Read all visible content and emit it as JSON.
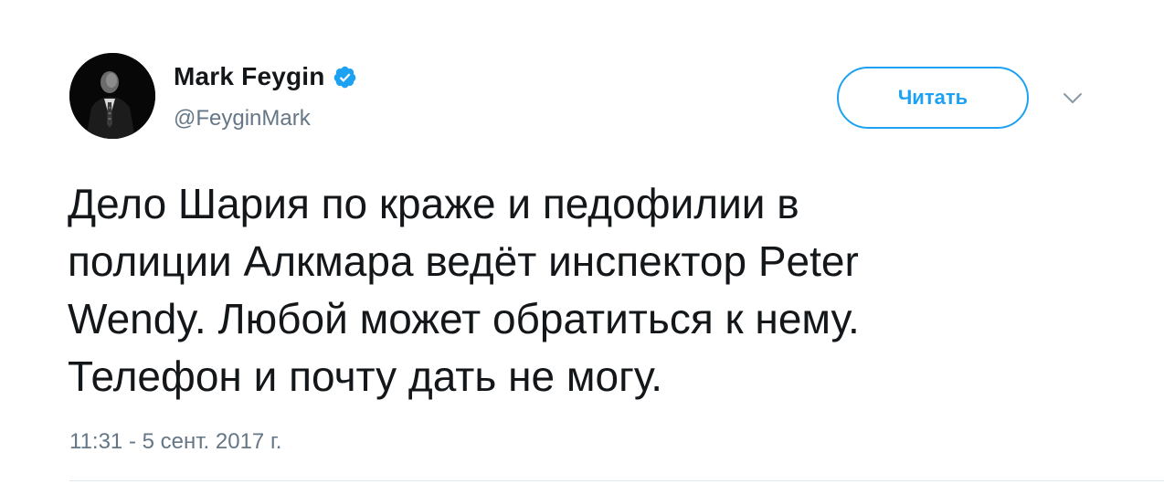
{
  "user": {
    "display_name": "Mark Feygin",
    "handle": "@FeyginMark",
    "verified": true
  },
  "follow_button": {
    "label": "Читать"
  },
  "menu": {
    "icon": "chevron-down-icon"
  },
  "tweet": {
    "text": "Дело Шария по краже и педофилии в\nполиции Алкмара ведёт инспектор Peter\nWendy. Любой может обратиться к нему.\nТелефон и почту дать не могу.",
    "timestamp": "11:31 - 5 сент. 2017 г."
  },
  "colors": {
    "accent": "#1da1f2",
    "secondary_text": "#657786",
    "primary_text": "#14171a"
  }
}
